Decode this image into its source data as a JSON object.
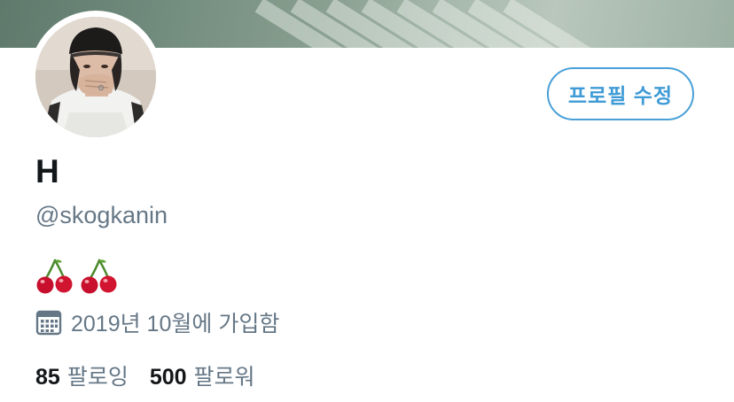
{
  "profile": {
    "display_name": "H",
    "handle": "@skogkanin",
    "bio_emojis": "🍒 🍒",
    "joined": "2019년 10월에 가입함",
    "edit_button": "프로필 수정"
  },
  "stats": {
    "following_count": "85",
    "following_label": "팔로잉",
    "followers_count": "500",
    "followers_label": "팔로워"
  },
  "icons": {
    "calendar": "calendar-icon",
    "cherry": "cherry-icon"
  },
  "colors": {
    "accent": "#3f9bd6",
    "secondary_text": "#657786",
    "primary_text": "#14171a"
  }
}
